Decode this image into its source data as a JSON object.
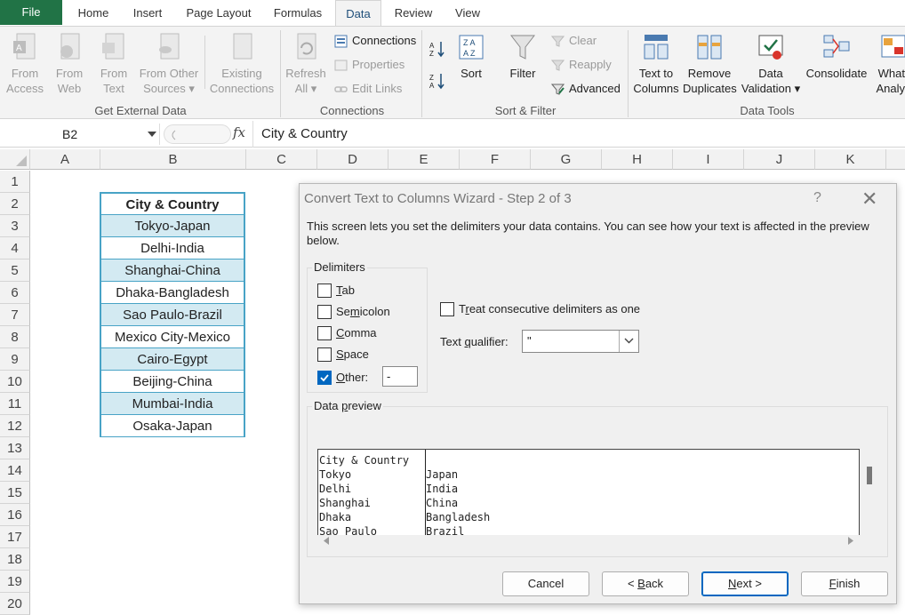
{
  "tabs": {
    "file": "File",
    "items": [
      "Home",
      "Insert",
      "Page Layout",
      "Formulas",
      "Data",
      "Review",
      "View"
    ],
    "active": "Data"
  },
  "ribbon": {
    "get_external": {
      "from_access": [
        "From",
        "Access"
      ],
      "from_web": [
        "From",
        "Web"
      ],
      "from_text": [
        "From",
        "Text"
      ],
      "from_other": [
        "From Other",
        "Sources ▾"
      ],
      "existing": [
        "Existing",
        "Connections"
      ],
      "label": "Get External Data"
    },
    "connections": {
      "refresh": [
        "Refresh",
        "All ▾"
      ],
      "connections": "Connections",
      "properties": "Properties",
      "edit_links": "Edit Links",
      "label": "Connections"
    },
    "sort_filter": {
      "sort": "Sort",
      "filter": "Filter",
      "clear": "Clear",
      "reapply": "Reapply",
      "advanced": "Advanced",
      "label": "Sort & Filter"
    },
    "data_tools": {
      "text_to_columns": [
        "Text to",
        "Columns"
      ],
      "remove_duplicates": [
        "Remove",
        "Duplicates"
      ],
      "data_validation": [
        "Data",
        "Validation ▾"
      ],
      "consolidate": "Consolidate",
      "what_if": [
        "What-",
        "Analys"
      ],
      "label": "Data Tools"
    }
  },
  "formula_bar": {
    "name_box": "B2",
    "fx": "fx",
    "formula": "City & Country"
  },
  "grid": {
    "columns": [
      "A",
      "B",
      "C",
      "D",
      "E",
      "F",
      "G",
      "H",
      "I",
      "J",
      "K"
    ],
    "rows": [
      "1",
      "2",
      "3",
      "4",
      "5",
      "6",
      "7",
      "8",
      "9",
      "10",
      "11",
      "12",
      "13",
      "14",
      "15",
      "16",
      "17",
      "18",
      "19",
      "20"
    ],
    "header": "City & Country",
    "cells": [
      "Tokyo-Japan",
      "Delhi-India",
      "Shanghai-China",
      "Dhaka-Bangladesh",
      "Sao Paulo-Brazil",
      "Mexico City-Mexico",
      "Cairo-Egypt",
      "Beijing-China",
      "Mumbai-India",
      "Osaka-Japan"
    ]
  },
  "dialog": {
    "title": "Convert Text to Columns Wizard - Step 2 of 3",
    "help": "?",
    "close": "✕",
    "description": "This screen lets you set the delimiters your data contains.  You can see how your text is affected in the preview below.",
    "delimiters_label": "Delimiters",
    "tab": {
      "pre": "",
      "key": "T",
      "post": "ab",
      "checked": false
    },
    "semicolon": {
      "pre": "Se",
      "key": "m",
      "post": "icolon",
      "checked": false
    },
    "comma": {
      "pre": "",
      "key": "C",
      "post": "omma",
      "checked": false
    },
    "space": {
      "pre": "",
      "key": "S",
      "post": "pace",
      "checked": false
    },
    "other": {
      "pre": "",
      "key": "O",
      "post": "ther:",
      "checked": true,
      "value": "-"
    },
    "consecutive": {
      "pre": "T",
      "key": "r",
      "post": "eat consecutive delimiters as one",
      "checked": false
    },
    "qualifier_label": {
      "pre": "Text ",
      "key": "q",
      "post": "ualifier:"
    },
    "qualifier_value": "\"",
    "preview_label": {
      "pre": "Data ",
      "key": "p",
      "post": "review"
    },
    "preview_col1": "City & Country\nTokyo\nDelhi\nShanghai\nDhaka\nSao Paulo",
    "preview_col2": "\nJapan\nIndia\nChina\nBangladesh\nBrazil",
    "buttons": {
      "cancel": "Cancel",
      "back": {
        "pre": "< ",
        "key": "B",
        "post": "ack"
      },
      "next": {
        "pre": "",
        "key": "N",
        "post": "ext >"
      },
      "finish": {
        "pre": "",
        "key": "F",
        "post": "inish"
      }
    }
  },
  "colors": {
    "excel_green": "#217346",
    "table_border": "#48a3c6",
    "band_fill": "#d3eaf2",
    "accent": "#0067c0"
  }
}
